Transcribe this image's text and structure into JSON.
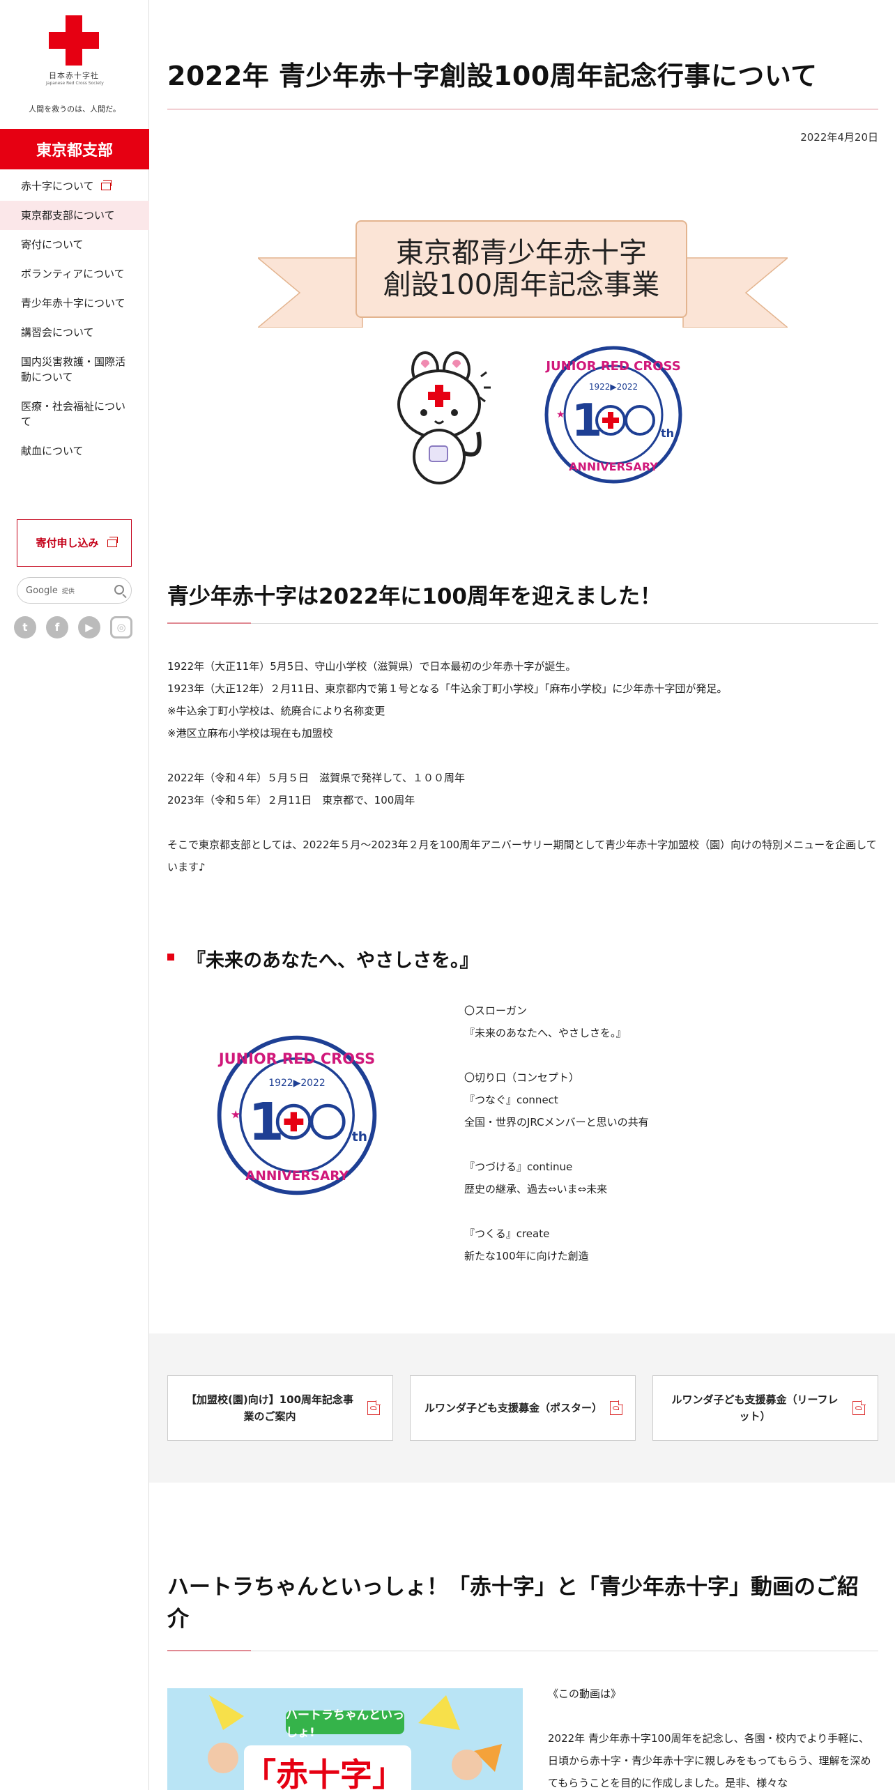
{
  "sidebar": {
    "org_name": "日本赤十字社",
    "org_name_en": "Japanese Red Cross Society",
    "tagline": "人間を救うのは、人間だ。",
    "branch": "東京都支部",
    "nav": [
      {
        "label": "赤十字について",
        "external": true
      },
      {
        "label": "東京都支部について",
        "active": true
      },
      {
        "label": "寄付について"
      },
      {
        "label": "ボランティアについて"
      },
      {
        "label": "青少年赤十字について"
      },
      {
        "label": "講習会について"
      },
      {
        "label": "国内災害救護・国際活動について"
      },
      {
        "label": "医療・社会福祉について"
      },
      {
        "label": "献血について"
      }
    ],
    "donate_button": "寄付申し込み",
    "search": {
      "brand": "Google",
      "suffix": "提供"
    },
    "social": [
      "twitter-icon",
      "facebook-icon",
      "youtube-icon",
      "instagram-icon"
    ]
  },
  "page": {
    "title": "2022年 青少年赤十字創設100周年記念行事について",
    "date": "2022年4月20日",
    "banner": {
      "line1": "東京都青少年赤十字",
      "line2": "創設100周年記念事業"
    },
    "emblem": {
      "top_text": "JUNIOR RED CROSS",
      "years": "1922▶2022",
      "bottom_text": "100th ANNIVERSARY"
    },
    "section1": {
      "heading": "青少年赤十字は2022年に100周年を迎えました！",
      "lines_a": [
        "1922年（大正11年）5月5日、守山小学校（滋賀県）で日本最初の少年赤十字が誕生。",
        "1923年（大正12年）２月11日、東京都内で第１号となる「牛込余丁町小学校」「麻布小学校」に少年赤十字団が発足。",
        "※牛込余丁町小学校は、統廃合により名称変更",
        "※港区立麻布小学校は現在も加盟校"
      ],
      "lines_b": [
        "2022年（令和４年）５月５日　滋賀県で発祥して、１００周年",
        "2023年（令和５年）２月11日　東京都で、100周年"
      ],
      "closing": "そこで東京都支部としては、2022年５月～2023年２月を100周年アニバーサリー期間として青少年赤十字加盟校（園）向けの特別メニューを企画しています♪"
    },
    "section2": {
      "heading": "『未来のあなたへ、やさしさを。』",
      "slogan_lines": [
        "〇スローガン",
        "『未来のあなたへ、やさしさを。』",
        "",
        "〇切り口（コンセプト）",
        "『つなぐ』connect",
        "全国・世界のJRCメンバーと思いの共有",
        "",
        "『つづける』continue",
        "歴史の継承、過去⇔いま⇔未来",
        "",
        "『つくる』create",
        "新たな100年に向けた創造"
      ]
    },
    "downloads": [
      {
        "label": "【加盟校(園)向け】100周年記念事業のご案内"
      },
      {
        "label": "ルワンダ子ども支援募金（ポスター）"
      },
      {
        "label": "ルワンダ子ども支援募金（リーフレット）"
      }
    ],
    "section3": {
      "heading": "ハートラちゃんといっしょ！「赤十字」と「青少年赤十字」動画のご紹介",
      "video_label": "ハートラちゃんといっしょ!",
      "video_big": "「赤十字」と",
      "intro": "《この動画は》",
      "body": "2022年 青少年赤十字100周年を記念し、各園・校内でより手軽に、日頃から赤十字・青少年赤十字に親しみをもってもらう、理解を深めてもらうことを目的に作成しました。是非、様々な"
    }
  },
  "colors": {
    "brand_red": "#e60012",
    "accent_pink": "#e08a93",
    "emblem_blue": "#1e3f94",
    "emblem_magenta": "#d0187a"
  }
}
